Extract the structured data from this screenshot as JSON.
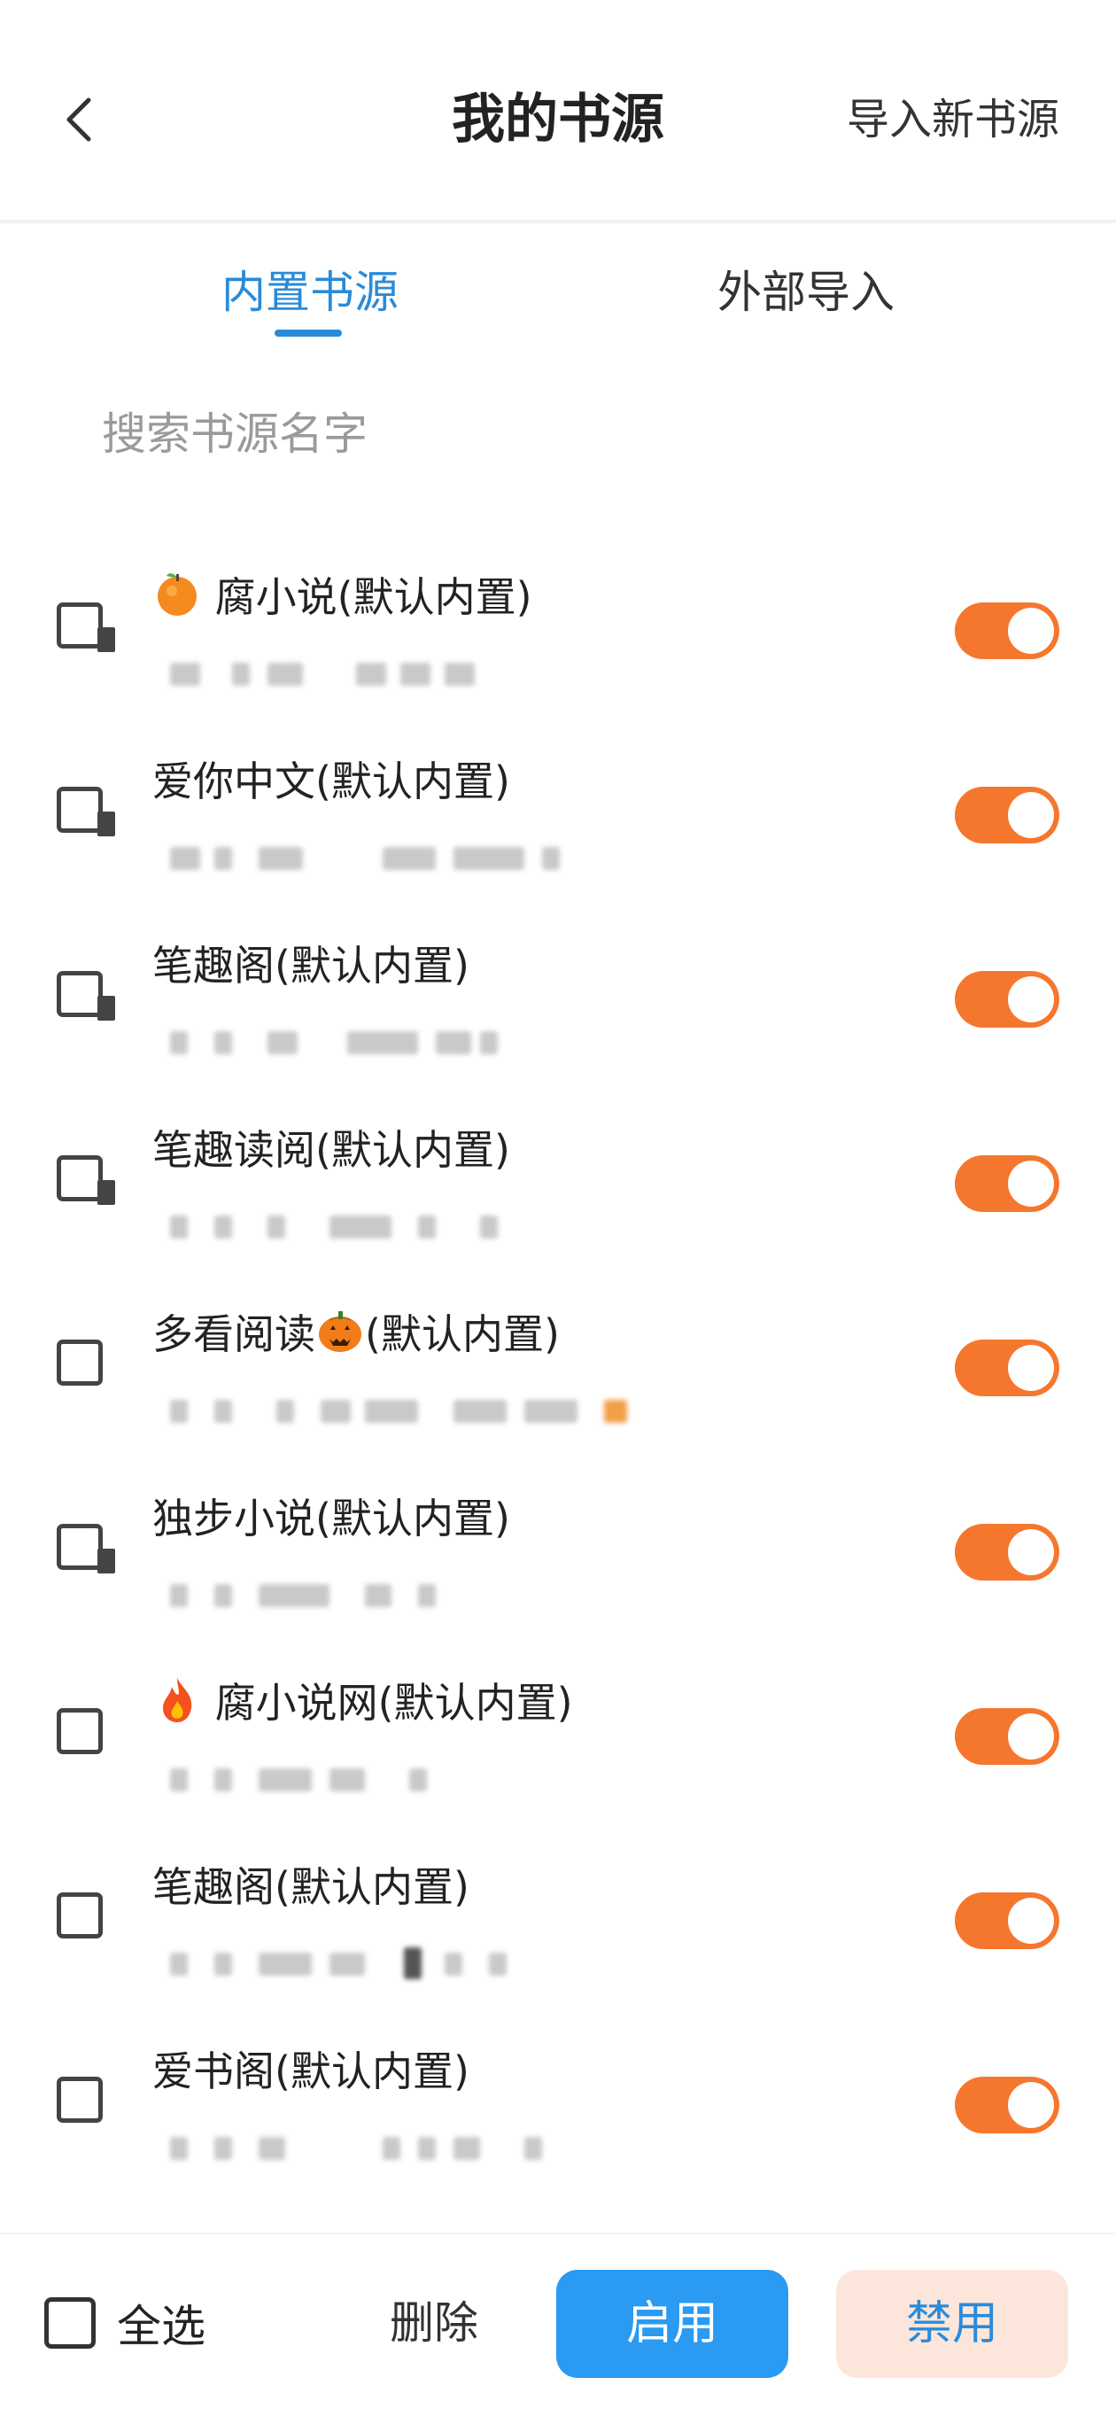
{
  "header": {
    "title": "我的书源",
    "import_label": "导入新书源",
    "back_icon": "chevron-left-icon"
  },
  "tabs": [
    {
      "label": "内置书源",
      "active": true
    },
    {
      "label": "外部导入",
      "active": false
    }
  ],
  "search": {
    "placeholder": "搜索书源名字",
    "value": ""
  },
  "sources": [
    {
      "title": "腐小说(默认内置)",
      "emoji": "tangerine",
      "enabled": true,
      "checked": false
    },
    {
      "title": "爱你中文(默认内置)",
      "emoji": "",
      "enabled": true,
      "checked": false
    },
    {
      "title": "笔趣阁(默认内置)",
      "emoji": "",
      "enabled": true,
      "checked": false
    },
    {
      "title": "笔趣读阅(默认内置)",
      "emoji": "",
      "enabled": true,
      "checked": false
    },
    {
      "title_prefix": "多看阅读",
      "title_suffix": "(默认内置)",
      "emoji": "pumpkin",
      "enabled": true,
      "checked": false
    },
    {
      "title": "独步小说(默认内置)",
      "emoji": "",
      "enabled": true,
      "checked": false
    },
    {
      "title": "腐小说网(默认内置)",
      "emoji": "fire",
      "enabled": true,
      "checked": false
    },
    {
      "title": "笔趣阁(默认内置)",
      "emoji": "",
      "enabled": true,
      "checked": false
    },
    {
      "title": "爱书阁(默认内置)",
      "emoji": "",
      "enabled": true,
      "checked": false
    }
  ],
  "bottom_bar": {
    "select_all_label": "全选",
    "delete_label": "删除",
    "enable_label": "启用",
    "disable_label": "禁用"
  },
  "colors": {
    "accent_blue": "#2a8bd8",
    "toggle_on": "#f5772e",
    "enable_button": "#2a9af2",
    "disable_button_bg": "#fce6dc"
  }
}
